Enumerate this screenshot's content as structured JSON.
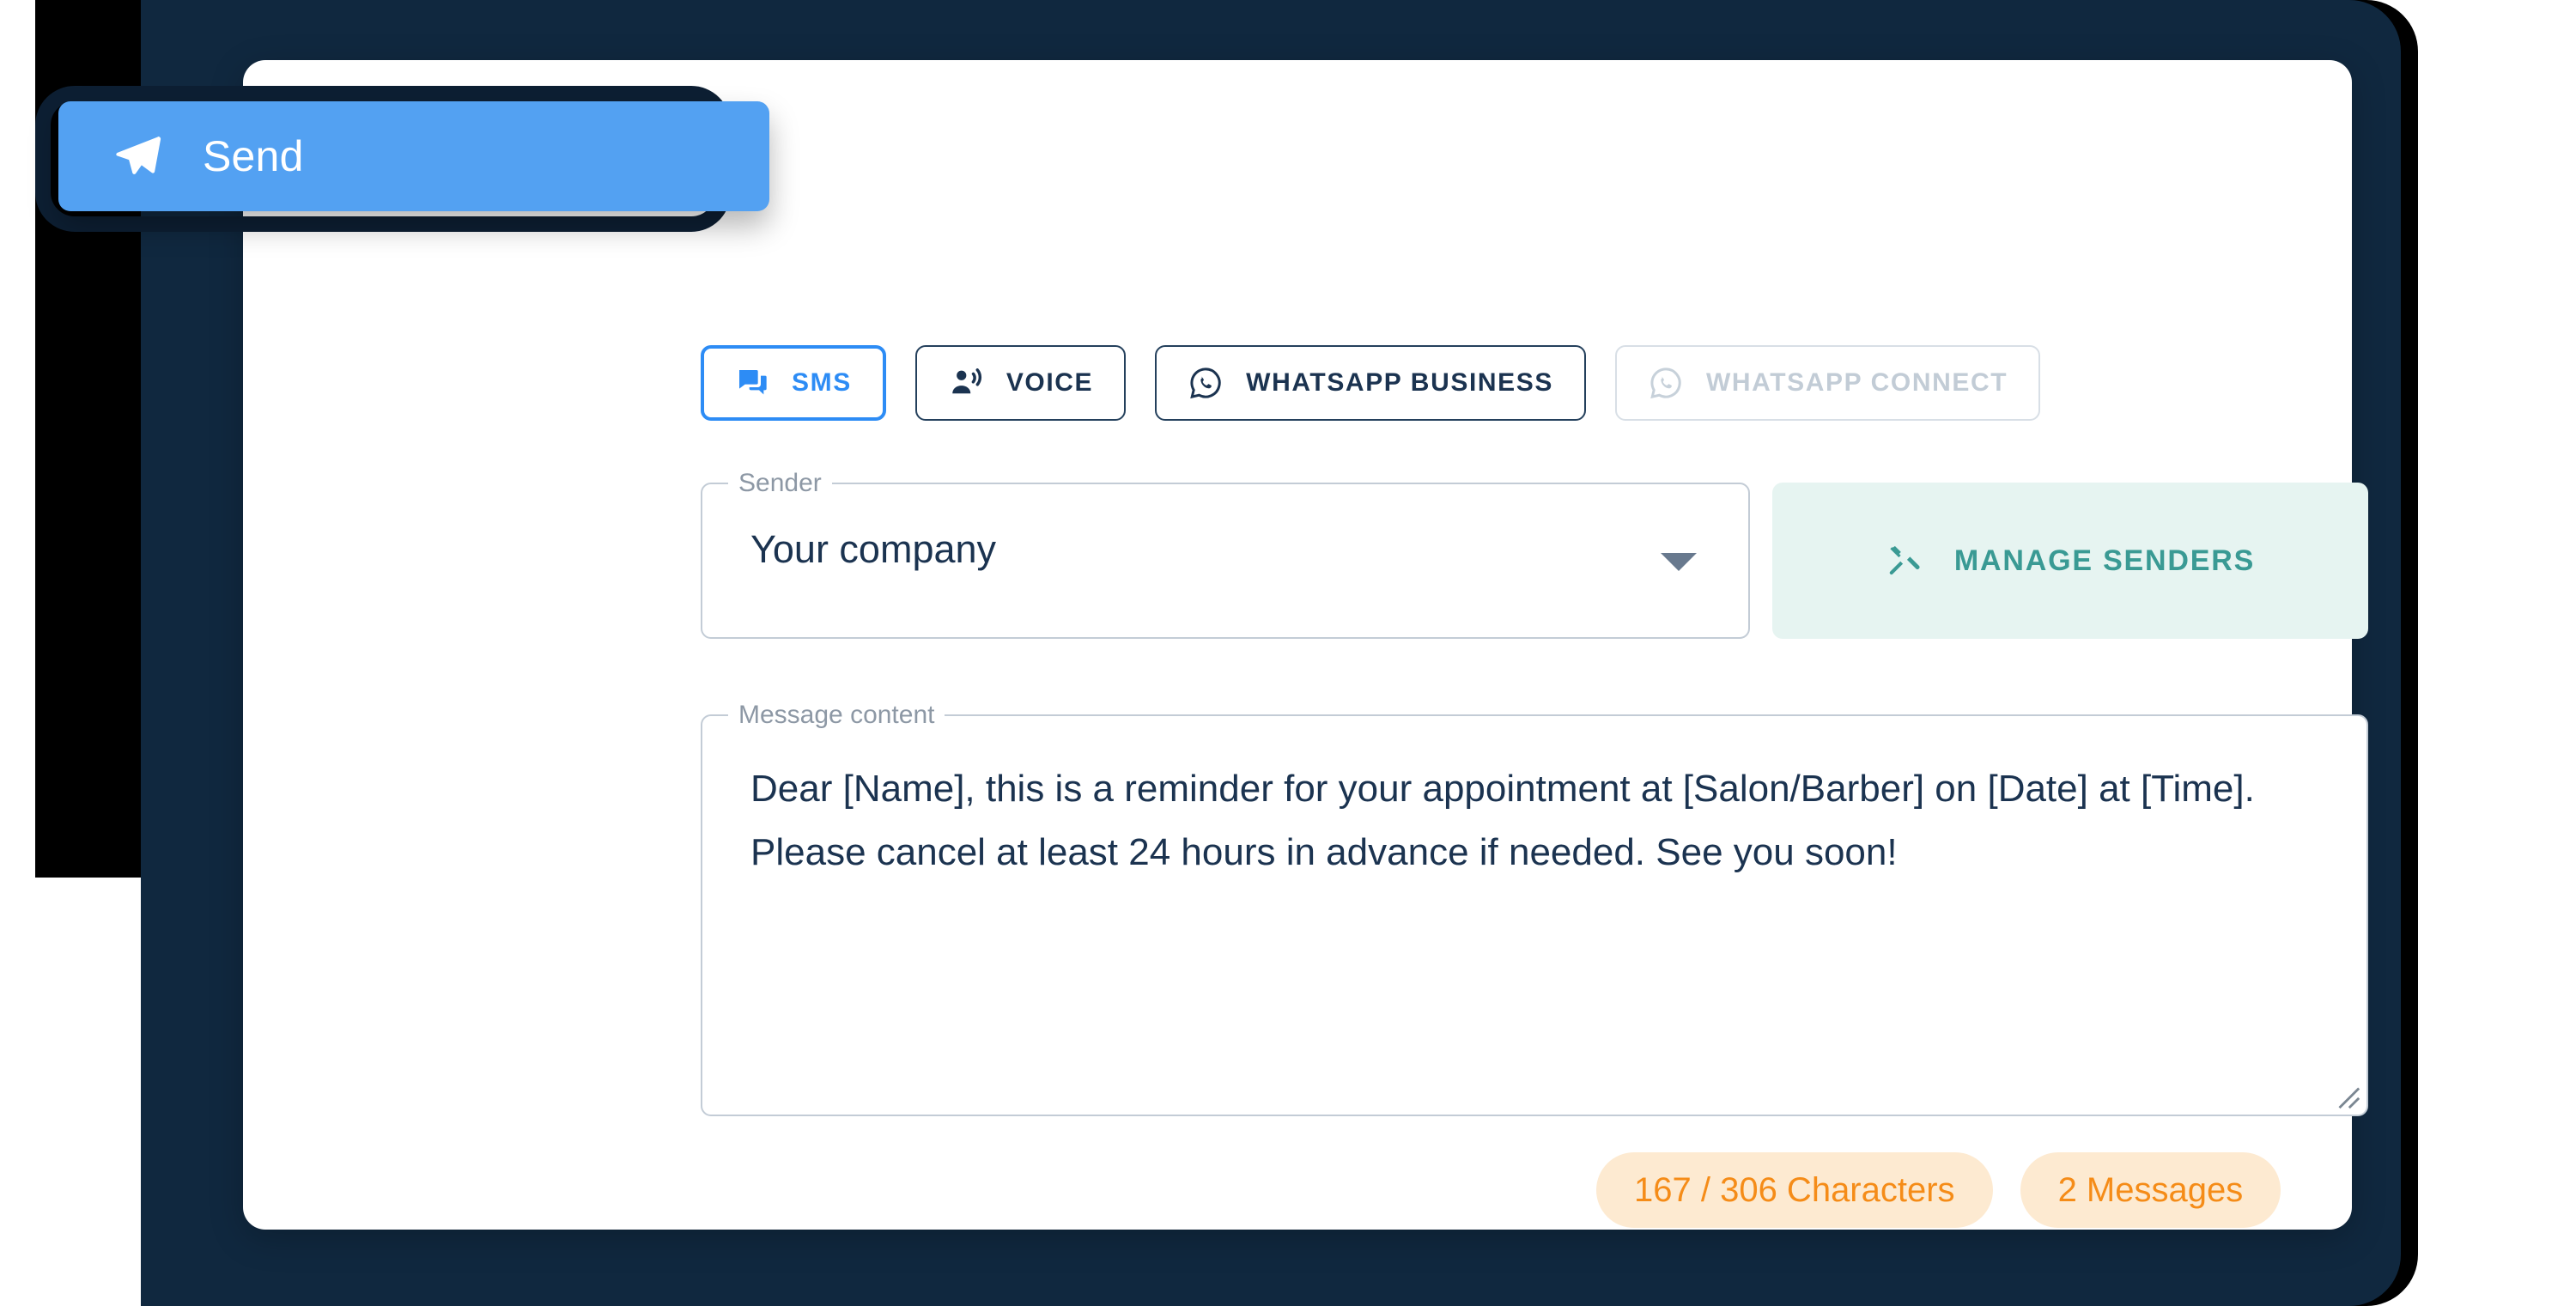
{
  "send_button": {
    "label": "Send",
    "icon": "paper-plane-icon",
    "color": "#53a1f2"
  },
  "channel_tabs": [
    {
      "label": "SMS",
      "icon": "chat-bubbles-icon",
      "state": "active"
    },
    {
      "label": "VOICE",
      "icon": "person-speaking-icon",
      "state": "default"
    },
    {
      "label": "WHATSAPP BUSINESS",
      "icon": "whatsapp-icon",
      "state": "default"
    },
    {
      "label": "WHATSAPP CONNECT",
      "icon": "whatsapp-icon",
      "state": "disabled"
    }
  ],
  "sender": {
    "legend": "Sender",
    "value": "Your company",
    "dropdown_icon": "chevron-down-icon"
  },
  "manage_senders": {
    "label": "MANAGE SENDERS",
    "icon": "tools-icon",
    "accent": "#3a9a94",
    "background": "#e6f4f1"
  },
  "message": {
    "legend": "Message content",
    "value": "Dear [Name], this is a reminder for your appointment at [Salon/Barber] on [Date] at [Time]. Please cancel at least 24 hours in advance if needed. See you soon!"
  },
  "counters": [
    {
      "label": "167 / 306 Characters"
    },
    {
      "label": "2 Messages"
    }
  ],
  "theme": {
    "accent_blue": "#2d8cf5",
    "navy": "#10283f",
    "text_navy": "#1b3350",
    "orange": "#f58c18",
    "chip_bg": "#fdead1"
  }
}
